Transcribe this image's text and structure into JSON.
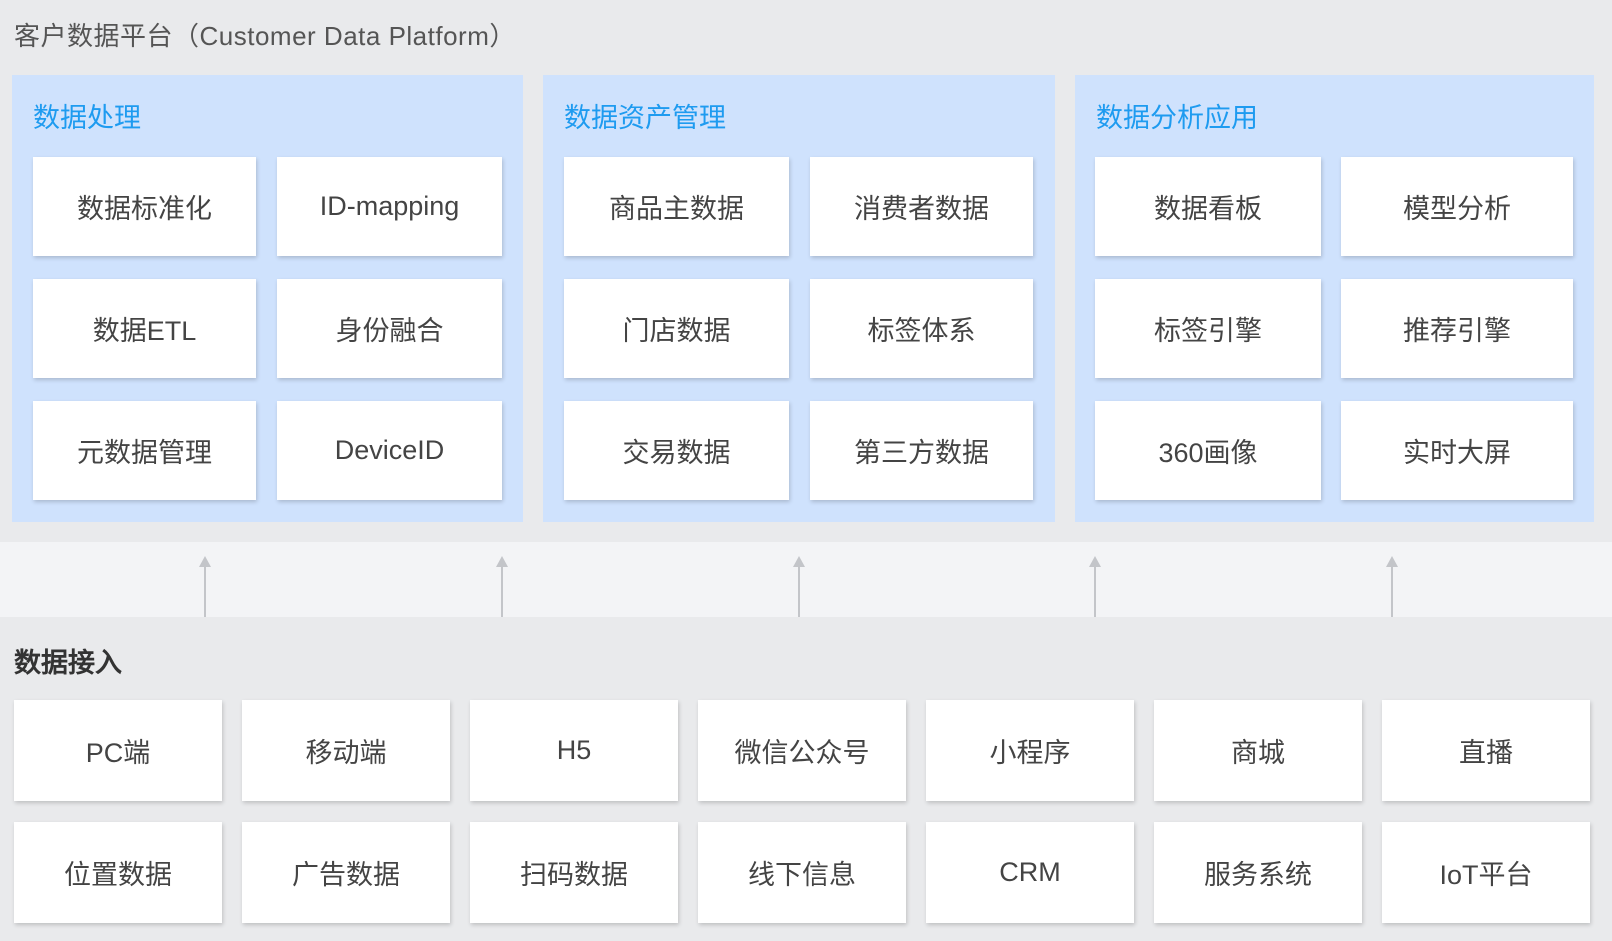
{
  "title": "客户数据平台（Customer Data Platform）",
  "panels": [
    {
      "title": "数据处理",
      "cards": [
        "数据标准化",
        "ID-mapping",
        "数据ETL",
        "身份融合",
        "元数据管理",
        "DeviceID"
      ]
    },
    {
      "title": "数据资产管理",
      "cards": [
        "商品主数据",
        "消费者数据",
        "门店数据",
        "标签体系",
        "交易数据",
        "第三方数据"
      ]
    },
    {
      "title": "数据分析应用",
      "cards": [
        "数据看板",
        "模型分析",
        "标签引擎",
        "推荐引擎",
        "360画像",
        "实时大屏"
      ]
    }
  ],
  "data_access": {
    "title": "数据接入",
    "sources": [
      "PC端",
      "移动端",
      "H5",
      "微信公众号",
      "小程序",
      "商城",
      "直播",
      "位置数据",
      "广告数据",
      "扫码数据",
      "线下信息",
      "CRM",
      "服务系统",
      "IoT平台"
    ]
  },
  "colors": {
    "background": "#e9eaec",
    "panel": "#cfe2fd",
    "panel_title": "#1e9bf0",
    "arrow": "#c3c5c9",
    "card": "#ffffff"
  }
}
